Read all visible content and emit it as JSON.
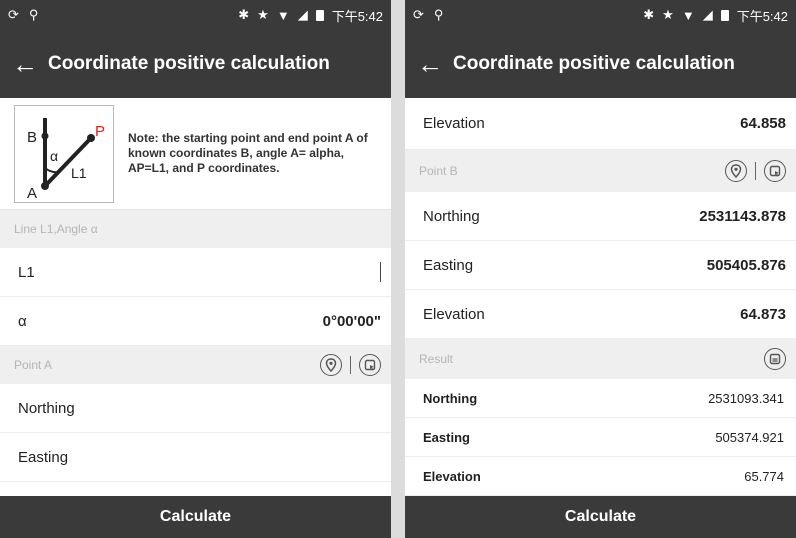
{
  "left": {
    "status": {
      "time": "下午5:42"
    },
    "app_title": "Coordinate positive calculation",
    "note": "Note: the starting point and end point A of known coordinates B, angle A= alpha, AP=L1, and P coordinates.",
    "diagram": {
      "b": "B",
      "p": "P",
      "alpha": "α",
      "l1": "L1",
      "a": "A"
    },
    "section_line": "Line L1,Angle α",
    "l1_label": "L1",
    "l1_value": "",
    "alpha_label": "α",
    "alpha_value": "0°00'00\"",
    "section_point_a": "Point A",
    "northing_label": "Northing",
    "easting_label": "Easting",
    "calculate": "Calculate"
  },
  "right": {
    "status": {
      "time": "下午5:42"
    },
    "app_title": "Coordinate positive calculation",
    "elevation_a_label": "Elevation",
    "elevation_a_value": "64.858",
    "section_point_b": "Point B",
    "northing_b_label": "Northing",
    "northing_b_value": "2531143.878",
    "easting_b_label": "Easting",
    "easting_b_value": "505405.876",
    "elevation_b_label": "Elevation",
    "elevation_b_value": "64.873",
    "section_result": "Result",
    "result": [
      {
        "label": "Northing",
        "value": "2531093.341"
      },
      {
        "label": "Easting",
        "value": "505374.921"
      },
      {
        "label": "Elevation",
        "value": "65.774"
      }
    ],
    "calculate": "Calculate"
  },
  "colors": {
    "bar": "#3a3a3a",
    "section_bg": "#efefef",
    "diagram_accent": "#e02020"
  }
}
